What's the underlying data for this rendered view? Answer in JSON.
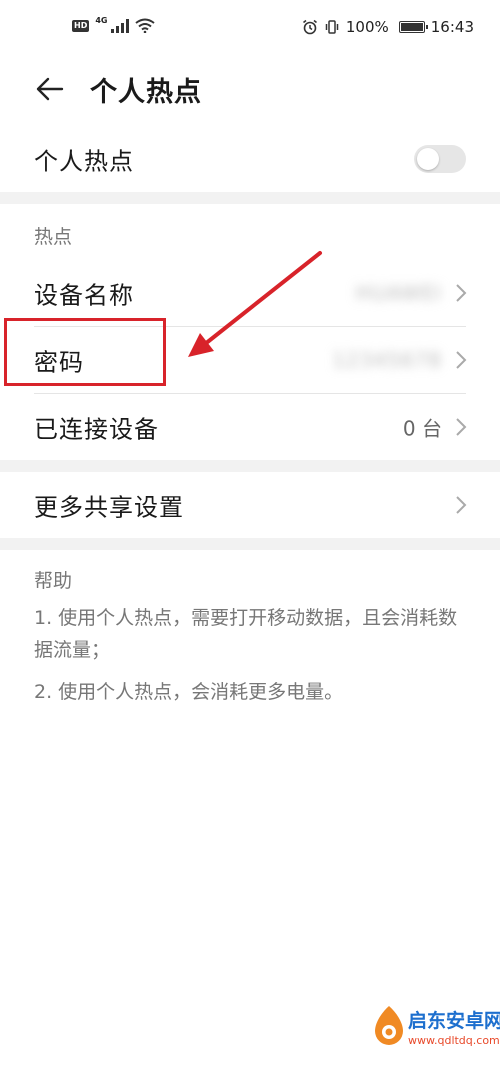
{
  "status_bar": {
    "hd_badge": "HD",
    "network_type": "4G",
    "battery_percent": "100%",
    "time": "16:43",
    "icons": [
      "hd-icon",
      "signal-icon",
      "wifi-icon",
      "alarm-icon",
      "vibrate-icon",
      "battery-icon"
    ]
  },
  "header": {
    "back_icon": "arrow-left-icon",
    "title": "个人热点"
  },
  "hotspot_toggle": {
    "label": "个人热点",
    "enabled": false
  },
  "hotspot_section": {
    "header": "热点",
    "items": [
      {
        "label": "设备名称",
        "value": "HUAWEI"
      },
      {
        "label": "密码",
        "value": "12345678"
      },
      {
        "label": "已连接设备",
        "value": "0 台"
      }
    ]
  },
  "more_settings": {
    "label": "更多共享设置"
  },
  "help": {
    "header": "帮助",
    "lines": [
      "1. 使用个人热点，需要打开移动数据，且会消耗数据流量；",
      "2. 使用个人热点，会消耗更多电量。"
    ]
  },
  "watermark": {
    "title": "启东安卓网",
    "url": "www.qdltdq.com"
  },
  "colors": {
    "annotation": "#d8232a",
    "band": "#f2f2f2",
    "watermark_blue": "#1d6fce",
    "watermark_orange": "#e8492a"
  }
}
